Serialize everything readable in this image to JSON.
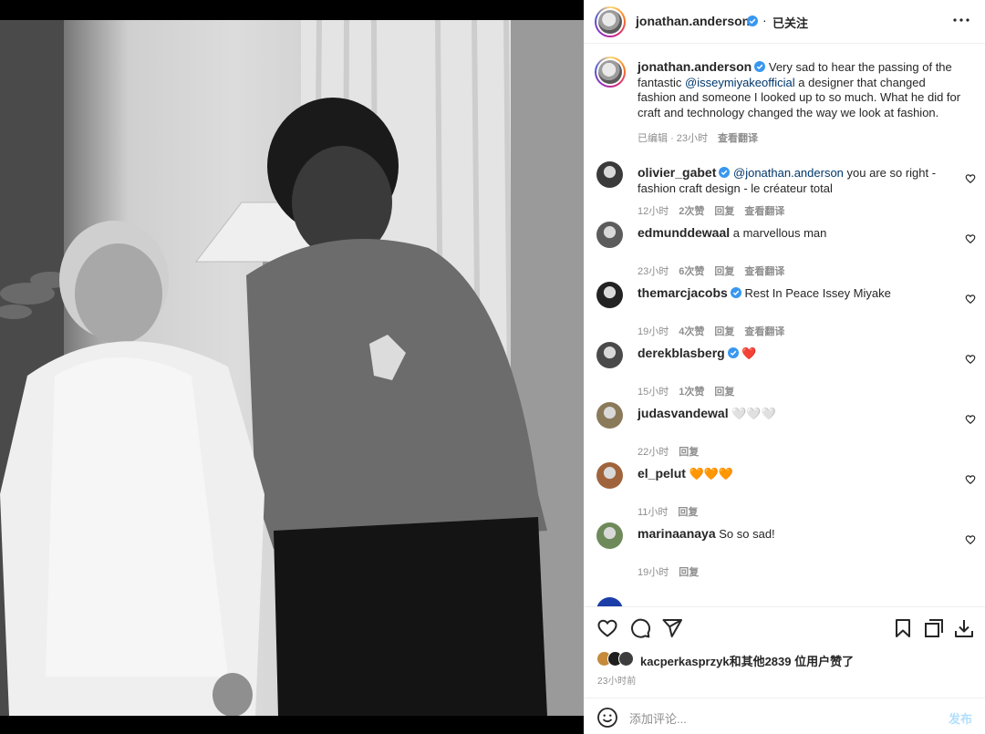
{
  "post": {
    "username": "jonathan.anderson",
    "follow_status": "已关注",
    "caption_prefix": "Very sad to hear the passing of the fantastic ",
    "caption_mention": "@isseymiyakeofficial",
    "caption_suffix": " a designer that changed fashion and someone I looked up to so much. What he did for craft and technology changed the way we look at fashion.",
    "edited": "已编辑",
    "time": "23小时",
    "translate": "查看翻译",
    "separator": "·"
  },
  "comments": [
    {
      "user": "olivier_gabet",
      "verified": true,
      "mention": "@jonathan.anderson",
      "text": " you are so right - fashion craft design - le créateur total",
      "time": "12小时",
      "likes": "2次赞",
      "reply": "回复",
      "translate": "查看翻译",
      "avatar_color": "#3a3a3a"
    },
    {
      "user": "edmunddewaal",
      "verified": false,
      "text": "a marvellous man",
      "time": "23小时",
      "likes": "6次赞",
      "reply": "回复",
      "translate": "查看翻译",
      "avatar_color": "#5c5c5c"
    },
    {
      "user": "themarcjacobs",
      "verified": true,
      "text": "Rest In Peace Issey Miyake",
      "time": "19小时",
      "likes": "4次赞",
      "reply": "回复",
      "translate": "查看翻译",
      "avatar_color": "#222222"
    },
    {
      "user": "derekblasberg",
      "verified": true,
      "text": "❤️",
      "time": "15小时",
      "likes": "1次赞",
      "reply": "回复",
      "avatar_color": "#4a4a4a"
    },
    {
      "user": "judasvandewal",
      "verified": false,
      "text": "🤍🤍🤍",
      "time": "22小时",
      "reply": "回复",
      "avatar_color": "#8a7a5a"
    },
    {
      "user": "el_pelut",
      "verified": false,
      "text": "🧡🧡🧡",
      "time": "11小时",
      "reply": "回复",
      "avatar_color": "#a0643c"
    },
    {
      "user": "marinaanaya",
      "verified": false,
      "text": "So so sad!",
      "time": "19小时",
      "reply": "回复",
      "avatar_color": "#6e8a5a"
    }
  ],
  "likes_summary": {
    "user": "kacperkasprzyk",
    "rest": "和其他2839 位用户赞了"
  },
  "posted_ago": "23小时前",
  "add_comment": {
    "placeholder": "添加评论...",
    "post_label": "发布"
  },
  "icons": [
    "more-icon",
    "heart-icon",
    "comment-icon",
    "share-icon",
    "save-icon",
    "carousel-icon",
    "download-icon",
    "emoji-icon",
    "verified-icon"
  ],
  "colors": {
    "verified": "#3897f0",
    "mention": "#00376b",
    "meta": "#8e8e8e",
    "post_disabled": "#b2dffc"
  }
}
